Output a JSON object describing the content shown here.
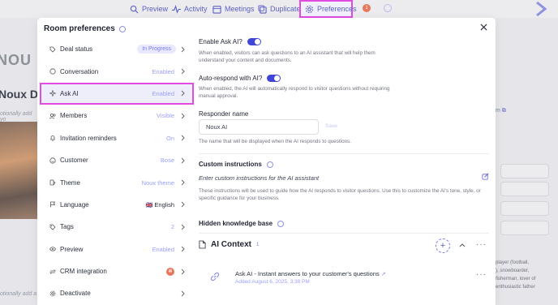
{
  "topbar": {
    "preview_label": "Preview",
    "activity_label": "Activity",
    "meetings_label": "Meetings",
    "duplicate_label": "Duplicate",
    "preferences_label": "Preferences",
    "notification_count": "1"
  },
  "background": {
    "logo_text": "NOU",
    "room_title": "Noux D",
    "subtitle": "otionally add yo",
    "subtitle2": "otionally add a",
    "copy_text": "m",
    "description_text": "player (football,\n), snowboarder,\nfisherman, lover of\nenthusiastic father"
  },
  "modal": {
    "title": "Room preferences"
  },
  "sidebar": {
    "items": [
      {
        "label": "Deal status",
        "value": "In Progress",
        "icon": "tag-icon"
      },
      {
        "label": "Conversation",
        "value": "Enabled",
        "icon": "chat-icon"
      },
      {
        "label": "Ask AI",
        "value": "Enabled",
        "icon": "sparkle-icon"
      },
      {
        "label": "Members",
        "value": "Visible",
        "icon": "users-icon"
      },
      {
        "label": "Invitation reminders",
        "value": "On",
        "icon": "bell-icon"
      },
      {
        "label": "Customer",
        "value": "Bose",
        "icon": "smile-icon"
      },
      {
        "label": "Theme",
        "value": "Noux theme",
        "icon": "palette-icon"
      },
      {
        "label": "Language",
        "value": "English",
        "flag": "🇬🇧",
        "icon": "flag-icon"
      },
      {
        "label": "Tags",
        "value": "2",
        "icon": "label-icon"
      },
      {
        "label": "Preview",
        "value": "Enabled",
        "icon": "eye-icon"
      },
      {
        "label": "CRM integration",
        "value": "",
        "icon": "sync-icon"
      },
      {
        "label": "Deactivate",
        "value": "",
        "icon": "gear-icon"
      }
    ]
  },
  "content": {
    "enable_ask_ai_label": "Enable Ask AI?",
    "enable_ask_ai_help": "When enabled, visitors can ask questions to an AI assistant that will help them understand your content and documents.",
    "auto_respond_label": "Auto-respond with AI?",
    "auto_respond_help": "When enabled, the AI will automatically respond to visitor questions without requiring manual approval.",
    "responder_name_label": "Responder name",
    "responder_name_value": "Noux AI",
    "save_label": "Save",
    "responder_name_help": "The name that will be displayed when the AI responds to questions.",
    "custom_instructions_title": "Custom instructions",
    "custom_instructions_placeholder": "Enter custom instructions for the AI assistant",
    "custom_instructions_help": "These instructions will be used to guide how the AI responds to visitor questions. Use this to customize the AI's tone, style, or specific guidance for your business.",
    "hidden_kb_title": "Hidden knowledge base",
    "ai_context_title": "AI Context",
    "ai_context_count": "1",
    "kb_item_title": "Ask AI - Instant answers to your customer's questions",
    "kb_item_date": "Added August 6, 2025, 3:38 PM"
  },
  "colors": {
    "accent": "#3f46d6",
    "highlight": "#e14be0",
    "value_text": "#9aa0ff",
    "badge": "#e8765a"
  }
}
